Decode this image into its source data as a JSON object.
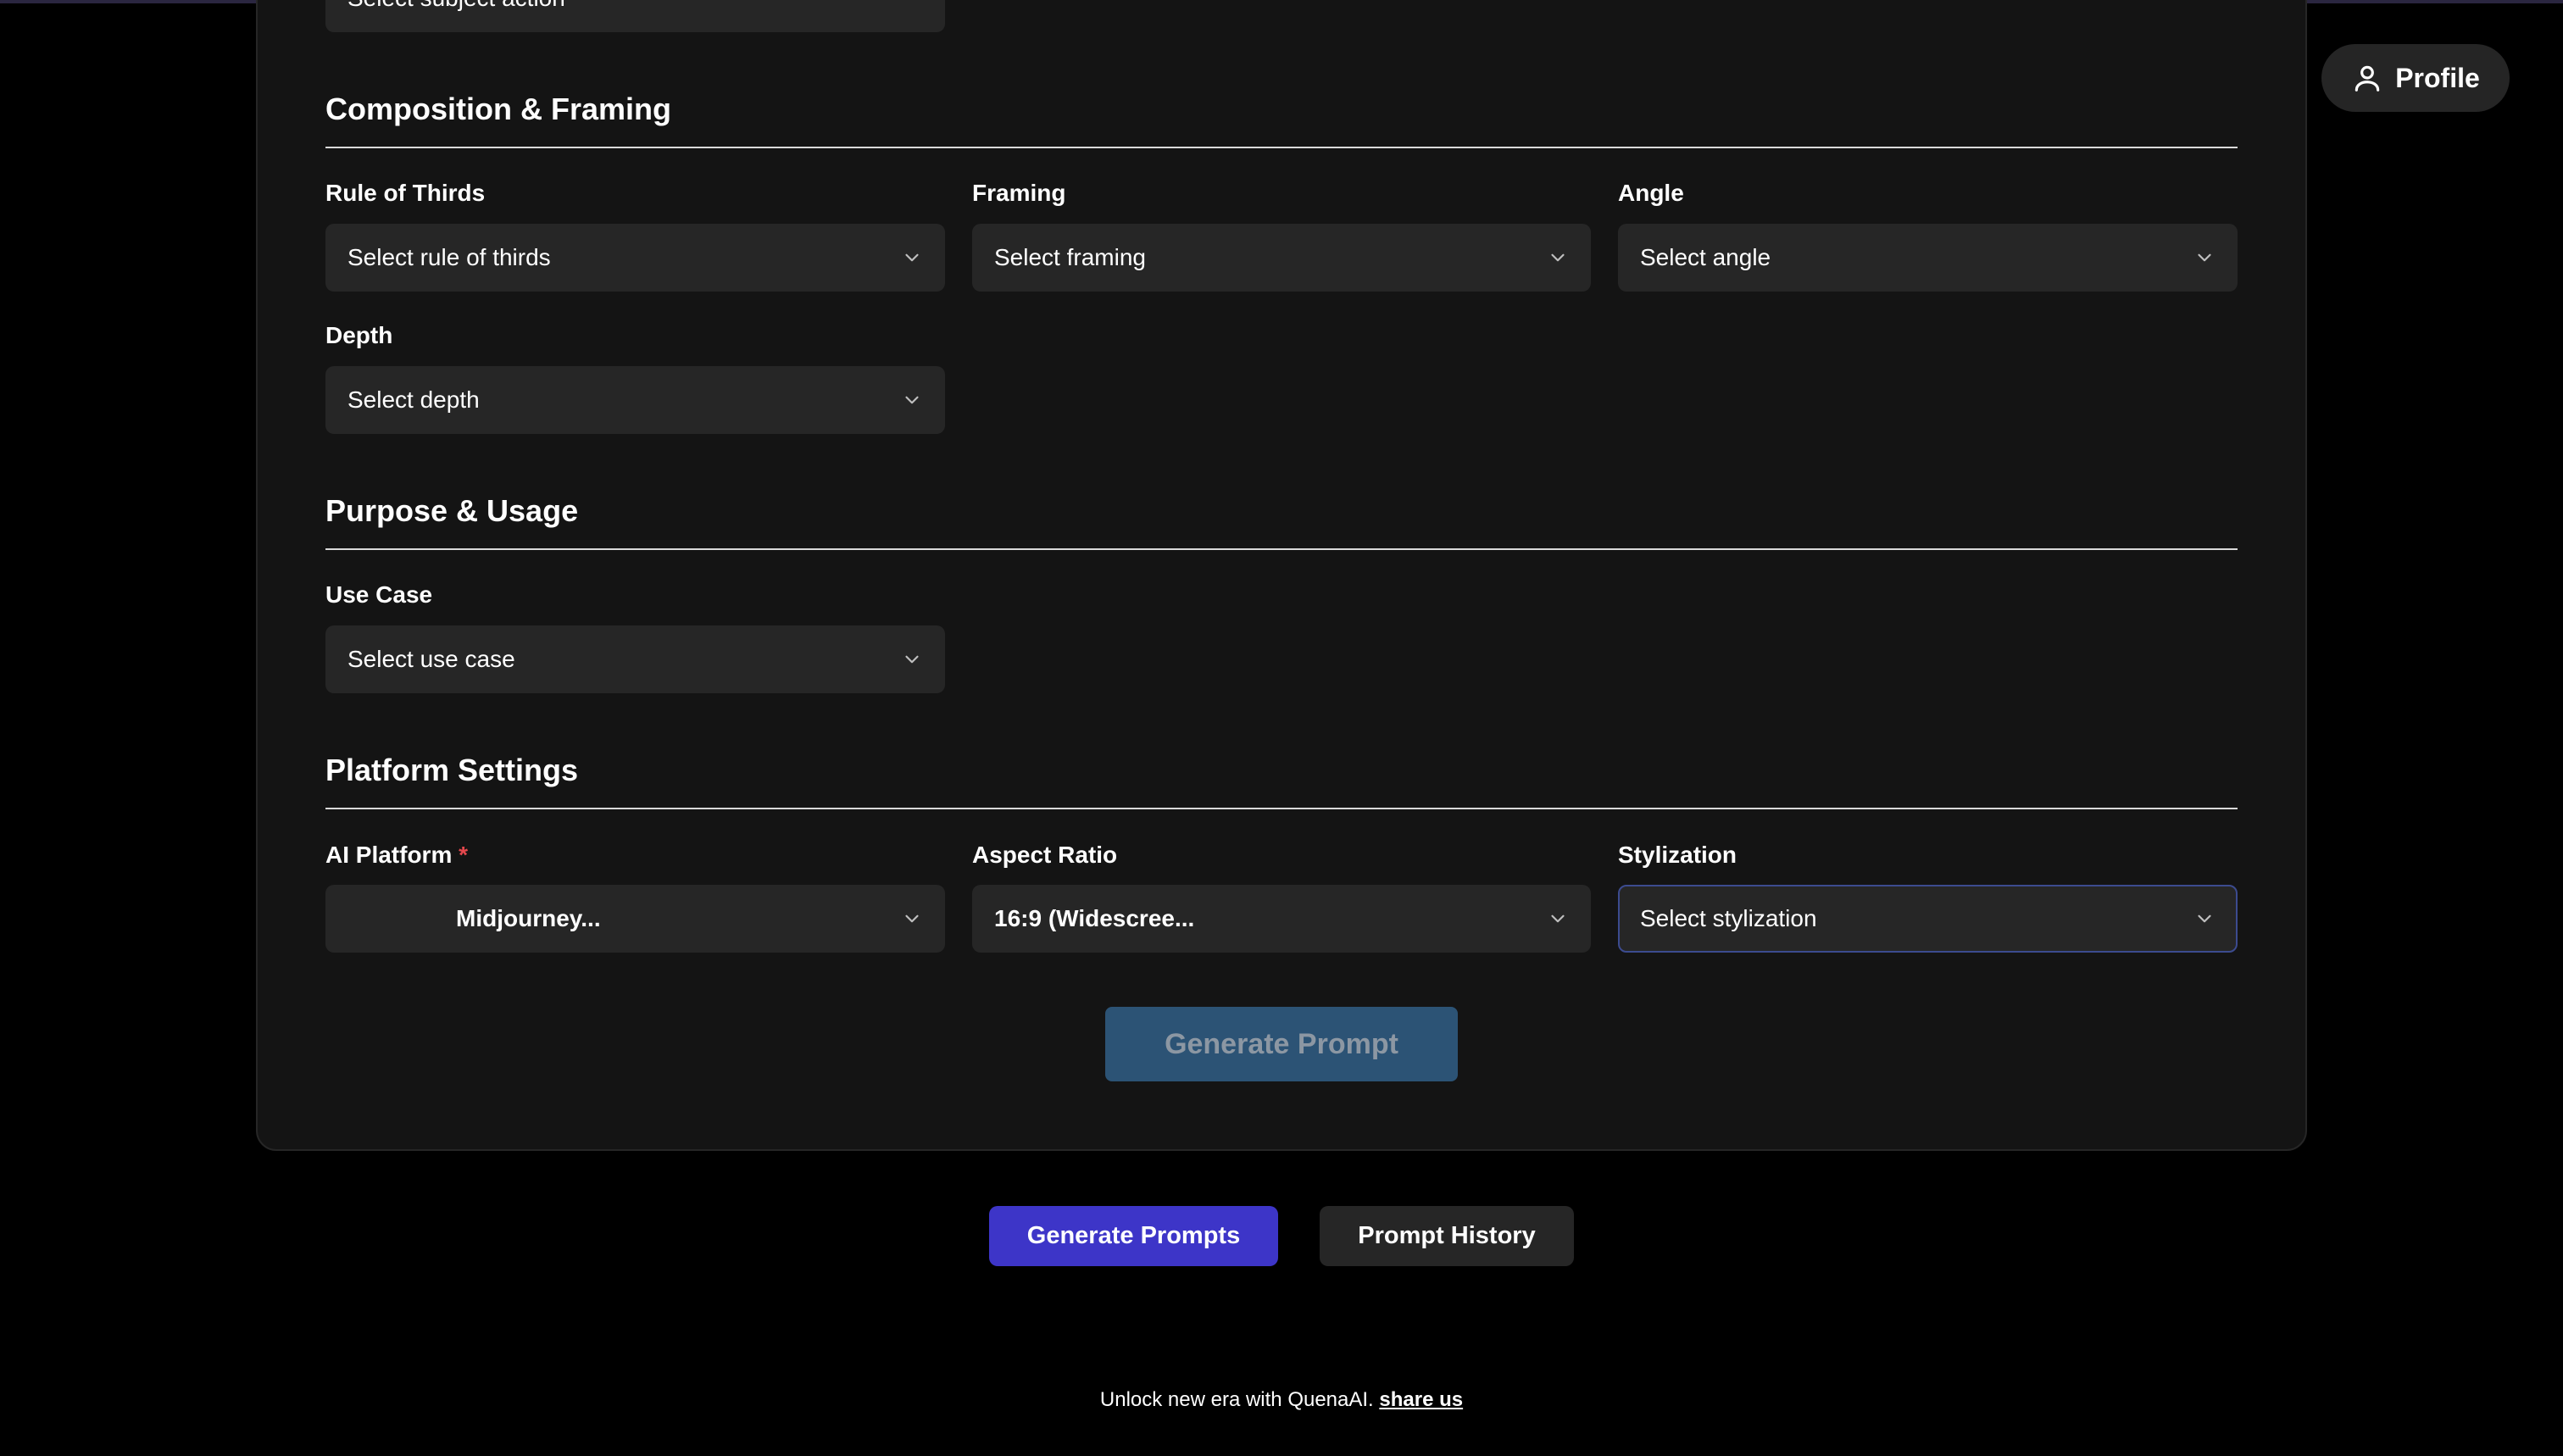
{
  "header": {
    "profile_label": "Profile",
    "profile_icon": "user-icon"
  },
  "form": {
    "subject_action_partial": "Select subject action",
    "sections": {
      "composition": {
        "title": "Composition & Framing",
        "rule_of_thirds": {
          "label": "Rule of Thirds",
          "value": "Select rule of thirds"
        },
        "framing": {
          "label": "Framing",
          "value": "Select framing"
        },
        "angle": {
          "label": "Angle",
          "value": "Select angle"
        },
        "depth": {
          "label": "Depth",
          "value": "Select depth"
        }
      },
      "purpose": {
        "title": "Purpose & Usage",
        "use_case": {
          "label": "Use Case",
          "value": "Select use case"
        }
      },
      "platform": {
        "title": "Platform Settings",
        "ai_platform": {
          "label": "AI Platform",
          "required_mark": "*",
          "value": "Midjourney..."
        },
        "aspect_ratio": {
          "label": "Aspect Ratio",
          "value": "16:9 (Widescree..."
        },
        "stylization": {
          "label": "Stylization",
          "value": "Select stylization"
        }
      }
    },
    "submit_label": "Generate Prompt"
  },
  "actions": {
    "generate_prompts_label": "Generate Prompts",
    "prompt_history_label": "Prompt History"
  },
  "footer": {
    "text": "Unlock new era with QuenaAI.",
    "link_label": "share us"
  },
  "colors": {
    "background": "#000000",
    "card": "#141414",
    "field": "#262626",
    "primary": "#3d35c8",
    "submit_disabled": "#2c5375",
    "required": "#e5484d"
  }
}
